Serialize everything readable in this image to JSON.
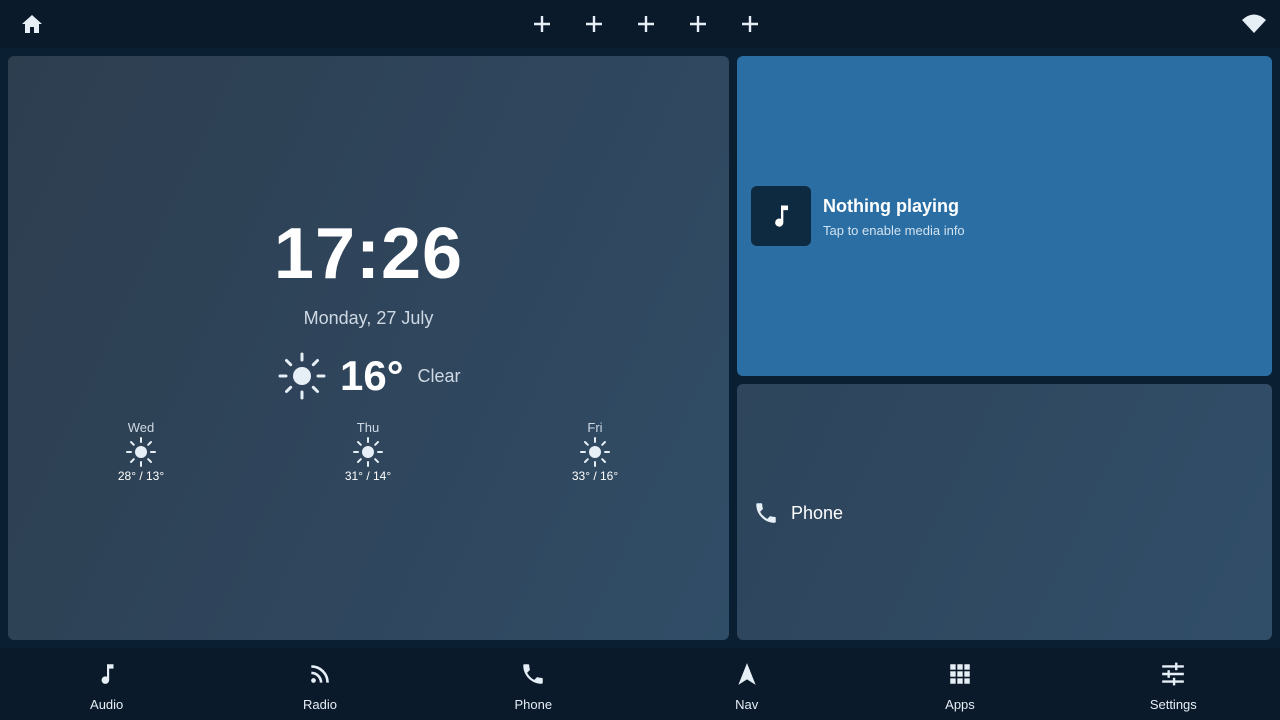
{
  "top_bar": {
    "home_icon": "home-icon",
    "shortcut_slots": [
      {
        "icon": "plus-icon"
      },
      {
        "icon": "plus-icon"
      },
      {
        "icon": "plus-icon"
      },
      {
        "icon": "plus-icon"
      },
      {
        "icon": "plus-icon"
      }
    ],
    "wifi_icon": "wifi-icon"
  },
  "clock": {
    "time": "17:26",
    "date": "Monday, 27 July"
  },
  "weather": {
    "current": {
      "icon": "sun-icon",
      "temp": "16°",
      "condition": "Clear"
    },
    "forecast": [
      {
        "day": "Wed",
        "icon": "sun-icon",
        "range": "28° / 13°"
      },
      {
        "day": "Thu",
        "icon": "sun-icon",
        "range": "31° / 14°"
      },
      {
        "day": "Fri",
        "icon": "sun-icon",
        "range": "33° / 16°"
      }
    ]
  },
  "media": {
    "icon": "music-note-icon",
    "title": "Nothing playing",
    "subtitle": "Tap to enable media info"
  },
  "phone_card": {
    "icon": "phone-icon",
    "label": "Phone"
  },
  "bottom_nav": [
    {
      "label": "Audio",
      "icon": "music-note-icon"
    },
    {
      "label": "Radio",
      "icon": "radio-icon"
    },
    {
      "label": "Phone",
      "icon": "phone-icon"
    },
    {
      "label": "Nav",
      "icon": "navigation-arrow-icon"
    },
    {
      "label": "Apps",
      "icon": "apps-grid-icon"
    },
    {
      "label": "Settings",
      "icon": "settings-sliders-icon"
    }
  ],
  "colors": {
    "background": "#0b1f33",
    "bar": "#0a1a2b",
    "media_accent": "#2a6ea3",
    "card": "#2f455b",
    "icon": "#dbe7f3"
  }
}
